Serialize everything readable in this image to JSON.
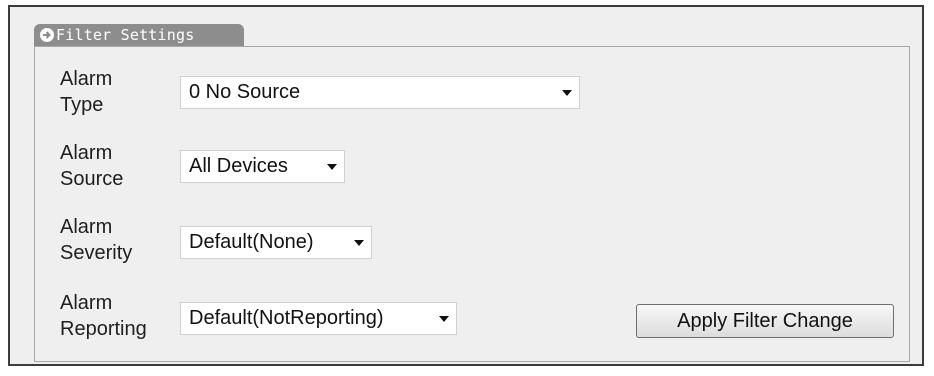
{
  "tab": {
    "label": "Filter Settings",
    "icon": "arrow-right-circle-icon"
  },
  "rows": [
    {
      "label_line1": "Alarm",
      "label_line2": "Type",
      "selected": "0 No Source"
    },
    {
      "label_line1": "Alarm",
      "label_line2": "Source",
      "selected": "All Devices"
    },
    {
      "label_line1": "Alarm",
      "label_line2": "Severity",
      "selected": "Default(None)"
    },
    {
      "label_line1": "Alarm",
      "label_line2": "Reporting",
      "selected": "Default(NotReporting)"
    }
  ],
  "apply_button": {
    "label": "Apply Filter Change"
  },
  "colors": {
    "tab_bg": "#8d8d8d",
    "panel_bg": "#efefef",
    "panel_border": "#a8a8a8",
    "frame_border": "#3c3c3c"
  }
}
